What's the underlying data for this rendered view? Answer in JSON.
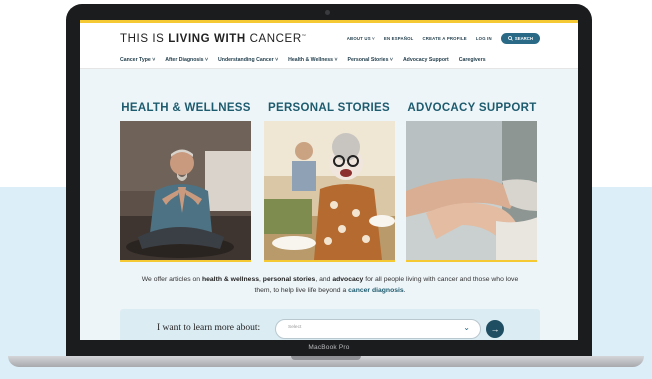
{
  "site": {
    "logo_pre": "THIS IS ",
    "logo_bold": "LIVING WITH",
    "logo_post": " CANCER",
    "logo_tm": "™",
    "util_nav": [
      "ABOUT US ˅",
      "EN ESPAÑOL",
      "CREATE A PROFILE",
      "LOG IN"
    ],
    "search_label": "SEARCH",
    "main_nav": [
      "Cancer Type ˅",
      "After Diagnosis ˅",
      "Understanding Cancer ˅",
      "Health & Wellness ˅",
      "Personal Stories ˅",
      "Advocacy Support",
      "Caregivers"
    ],
    "columns": [
      {
        "title": "HEALTH & WELLNESS"
      },
      {
        "title": "PERSONAL STORIES"
      },
      {
        "title": "ADVOCACY SUPPORT"
      }
    ],
    "blurb": {
      "t1": "We offer articles on ",
      "b1": "health & wellness",
      "t2": ", ",
      "b2": "personal stories",
      "t3": ", and ",
      "b3": "advocacy",
      "t4": " for all people living with cancer and those who love them, to help live life beyond a ",
      "link": "cancer diagnosis",
      "t5": "."
    },
    "learn": {
      "label": "I want to learn more about:",
      "select_placeholder": "Select",
      "go_symbol": "→"
    }
  },
  "device": {
    "model_label": "MacBook Pro"
  },
  "colors": {
    "accent_yellow": "#f4c934",
    "brand_teal": "#1d5b6e",
    "search_blue": "#2a6a86",
    "background_band": "#dceef8"
  }
}
